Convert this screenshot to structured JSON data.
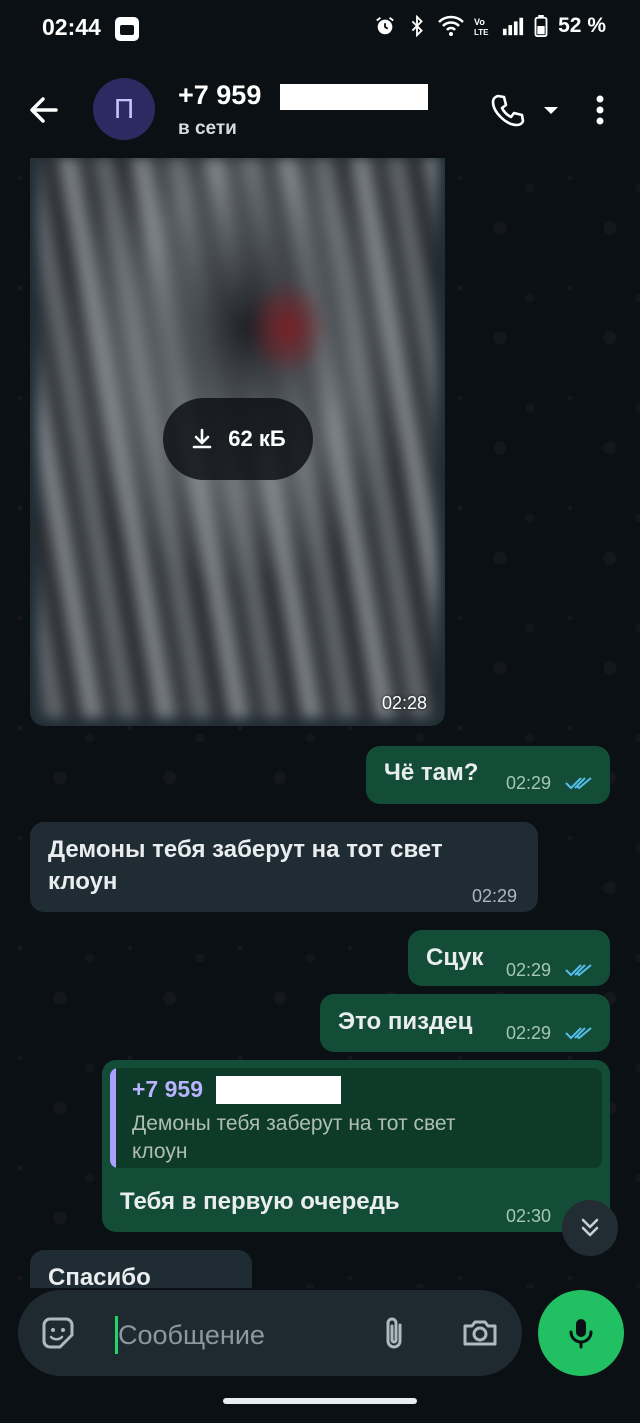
{
  "status_bar": {
    "time": "02:44",
    "battery": "52 %",
    "icons": [
      "app-icon",
      "alarm-icon",
      "bluetooth-icon",
      "wifi-icon",
      "volte-icon",
      "signal-icon",
      "battery-icon"
    ]
  },
  "header": {
    "avatar_letter": "П",
    "contact_name": "+7 959",
    "status": "в сети",
    "icons": [
      "back-arrow-icon",
      "phone-icon",
      "dropdown-icon",
      "more-vertical-icon"
    ]
  },
  "messages": [
    {
      "type": "image",
      "direction": "in",
      "size_label": "62 кБ",
      "time": "02:28"
    },
    {
      "type": "text",
      "direction": "out",
      "text": "Чё там?",
      "time": "02:29",
      "read": true
    },
    {
      "type": "text",
      "direction": "in",
      "text_lines": [
        "Демоны тебя заберут на тот свет",
        "клоун"
      ],
      "time": "02:29"
    },
    {
      "type": "text",
      "direction": "out",
      "text": "Сцук",
      "time": "02:29",
      "read": true
    },
    {
      "type": "text",
      "direction": "out",
      "text": "Это пиздец",
      "time": "02:29",
      "read": true
    },
    {
      "type": "reply",
      "direction": "out",
      "quoted_name": "+7 959",
      "quoted_lines": [
        "Демоны тебя заберут на тот свет",
        "клоун"
      ],
      "text": "Тебя в первую очередь",
      "time": "02:30"
    },
    {
      "type": "text",
      "direction": "in",
      "text": "Спасибо",
      "partial": true
    }
  ],
  "composer": {
    "placeholder": "Сообщение",
    "icons": [
      "sticker-icon",
      "attach-icon",
      "camera-icon",
      "mic-icon"
    ]
  },
  "colors": {
    "background": "#0b1014",
    "incoming_bubble": "#1f2c34",
    "outgoing_bubble": "#144d37",
    "accent_green": "#21c063",
    "read_ticks": "#53bdeb"
  }
}
